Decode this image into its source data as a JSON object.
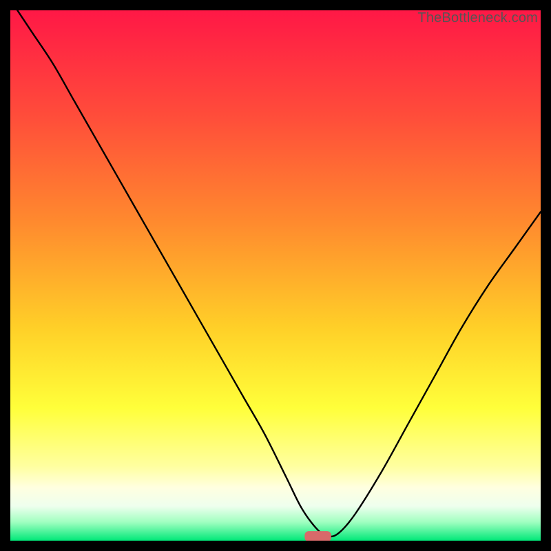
{
  "watermark": "TheBottleneck.com",
  "chart_data": {
    "type": "line",
    "title": "",
    "xlabel": "",
    "ylabel": "",
    "xlim": [
      0,
      100
    ],
    "ylim": [
      0,
      100
    ],
    "grid": false,
    "legend": false,
    "background_gradient": {
      "stops": [
        {
          "offset": 0.0,
          "color": "#ff1846"
        },
        {
          "offset": 0.2,
          "color": "#ff4d3a"
        },
        {
          "offset": 0.4,
          "color": "#ff8a2e"
        },
        {
          "offset": 0.6,
          "color": "#ffd028"
        },
        {
          "offset": 0.75,
          "color": "#ffff3a"
        },
        {
          "offset": 0.86,
          "color": "#ffffa0"
        },
        {
          "offset": 0.9,
          "color": "#ffffe0"
        },
        {
          "offset": 0.935,
          "color": "#eeffee"
        },
        {
          "offset": 0.965,
          "color": "#a0ffc0"
        },
        {
          "offset": 1.0,
          "color": "#00e878"
        }
      ]
    },
    "series": [
      {
        "name": "bottleneck-curve",
        "stroke": "#000000",
        "stroke_width": 2.4,
        "x": [
          0,
          4,
          8,
          12,
          16,
          20,
          24,
          28,
          32,
          36,
          40,
          44,
          48,
          52,
          55,
          58,
          60,
          62,
          65,
          70,
          75,
          80,
          85,
          90,
          95,
          100
        ],
        "y": [
          102,
          96,
          90,
          83,
          76,
          69,
          62,
          55,
          48,
          41,
          34,
          27,
          20,
          12,
          6,
          2,
          0.8,
          1.5,
          5,
          13,
          22,
          31,
          40,
          48,
          55,
          62
        ]
      }
    ],
    "marker": {
      "name": "sweet-spot-marker",
      "x_center": 58,
      "y": 0.8,
      "width_units": 5,
      "height_units": 2.0,
      "color": "#d86a6a",
      "rx": 6
    }
  }
}
